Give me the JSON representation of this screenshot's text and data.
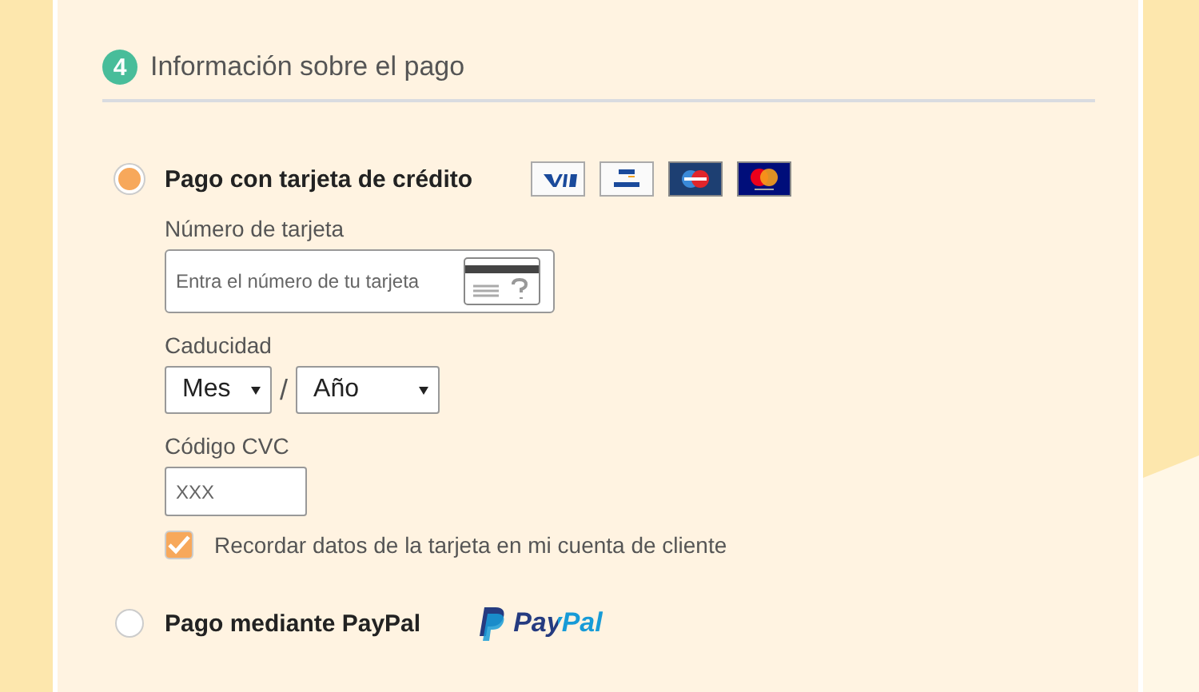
{
  "section": {
    "step": "4",
    "title": "Información sobre el pago"
  },
  "methods": [
    {
      "kind": "card",
      "label": "Pago con tarjeta de crédito",
      "selected": true
    },
    {
      "kind": "paypal",
      "label": "Pago mediante PayPal",
      "selected": false,
      "logo_text": "PayPal"
    }
  ],
  "card_form": {
    "number_label": "Número de tarjeta",
    "number_placeholder": "Entra el número de tu tarjeta",
    "expiry_label": "Caducidad",
    "month": "Mes",
    "separator": "/",
    "year": "Año",
    "cvc_label": "Código CVC",
    "cvc_placeholder": "XXX",
    "remember": {
      "label": "Recordar datos de la tarjeta en mi cuenta de cliente",
      "checked": true
    }
  }
}
